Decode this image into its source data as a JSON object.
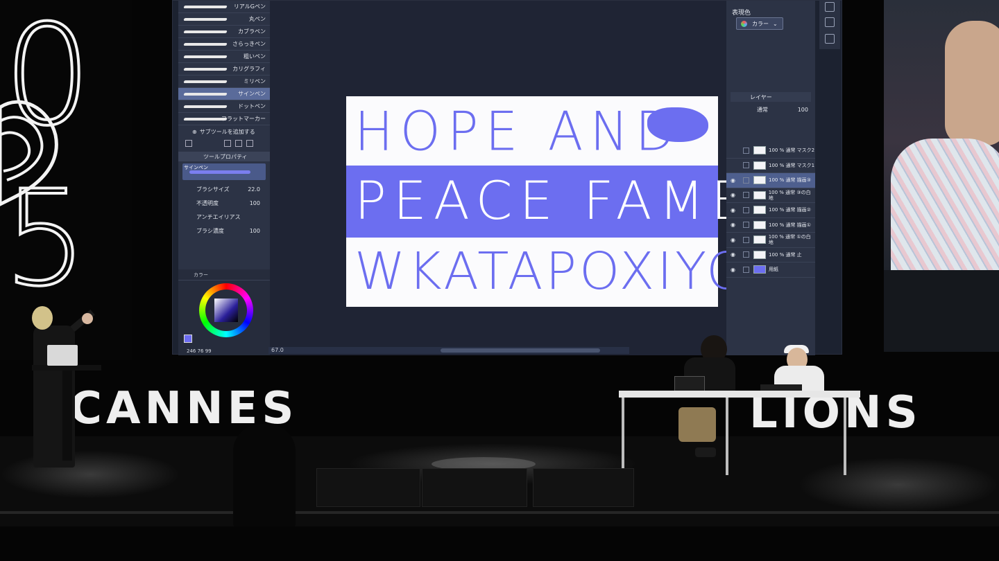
{
  "led_left": {
    "digit_top": "0",
    "digit_bottom": "5"
  },
  "app": {
    "sub_tools": [
      "リアルGペン",
      "丸ペン",
      "カブラペン",
      "さらっきペン",
      "粗いペン",
      "カリグラフィ",
      "ミリペン",
      "サインペン",
      "ドットペン",
      "フラットマーカー"
    ],
    "selected_sub_tool_index": 7,
    "add_sub_tool_label": "サブツールを追加する",
    "tool_property_title": "ツールプロパティ",
    "tool_property_tool": "サインペン",
    "properties": [
      {
        "label": "ブラシサイズ",
        "value": "22.0"
      },
      {
        "label": "不透明度",
        "value": "100"
      },
      {
        "label": "アンチエイリアス",
        "value": ""
      },
      {
        "label": "ブラシ濃度",
        "value": "100"
      }
    ],
    "color_tab_label": "カラー",
    "color_readout": "246  76  99",
    "fg_color": "#6d6df2",
    "zoom_readout": "67.0",
    "display_color_label": "表現色",
    "display_color_value": "カラー",
    "layer_panel_title": "レイヤー",
    "blend_mode": "通常",
    "layer_opacity": "100",
    "layers": [
      {
        "label": "100 % 通常 マスク2",
        "active": false,
        "visible": false
      },
      {
        "label": "100 % 通常 マスク1",
        "active": false,
        "visible": false
      },
      {
        "label": "100 % 通常 描画③",
        "active": true,
        "visible": true
      },
      {
        "label": "100 % 通常 ③の白地",
        "active": false,
        "visible": true
      },
      {
        "label": "100 % 通常 描画②",
        "active": false,
        "visible": true
      },
      {
        "label": "100 % 通常 描画①",
        "active": false,
        "visible": true
      },
      {
        "label": "100 % 通常 ①の白地",
        "active": false,
        "visible": true
      },
      {
        "label": "100 % 通常 止",
        "active": false,
        "visible": true
      },
      {
        "label": "用紙",
        "active": false,
        "visible": true
      }
    ]
  },
  "artwork": {
    "line1": "HOPE AND",
    "line2": "PEACE FAME",
    "line3": "WKATAPOXIYOX?",
    "accent_color": "#6c6ef0"
  },
  "signage": {
    "left": "CANNES",
    "right": "LIONS"
  }
}
